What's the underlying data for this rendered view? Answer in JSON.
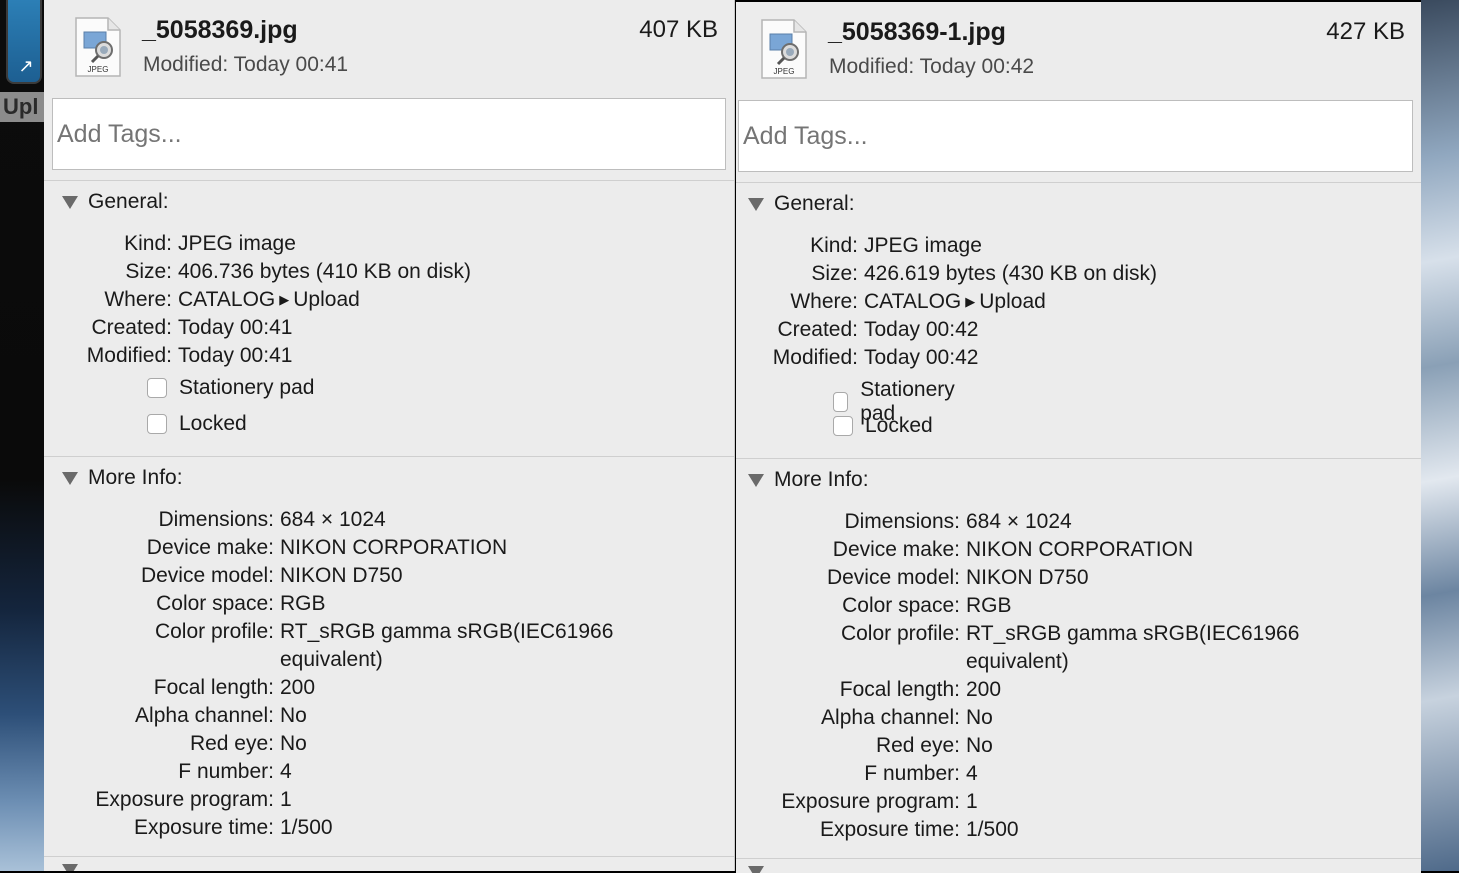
{
  "desktop": {
    "dock_label": "Upl"
  },
  "panels": [
    {
      "file_name": "_5058369.jpg",
      "file_size": "407 KB",
      "modified_line": "Modified: Today 00:41",
      "icon_badge": "JPEG",
      "tags_placeholder": "Add Tags...",
      "general": {
        "title": "General:",
        "kind_label": "Kind:",
        "kind": "JPEG image",
        "size_label": "Size:",
        "size": "406.736 bytes (410 KB on disk)",
        "where_label": "Where:",
        "where_path": [
          "CATALOG",
          "Upload"
        ],
        "created_label": "Created:",
        "created": "Today 00:41",
        "modified_label": "Modified:",
        "modified": "Today 00:41",
        "stationery_label": "Stationery pad",
        "locked_label": "Locked"
      },
      "more_info": {
        "title": "More Info:",
        "dimensions_label": "Dimensions:",
        "dimensions": "684 × 1024",
        "device_make_label": "Device make:",
        "device_make": "NIKON CORPORATION",
        "device_model_label": "Device model:",
        "device_model": "NIKON D750",
        "color_space_label": "Color space:",
        "color_space": "RGB",
        "color_profile_label": "Color profile:",
        "color_profile_1": "RT_sRGB gamma sRGB(IEC61966",
        "color_profile_2": "equivalent)",
        "focal_length_label": "Focal length:",
        "focal_length": "200",
        "alpha_channel_label": "Alpha channel:",
        "alpha_channel": "No",
        "red_eye_label": "Red eye:",
        "red_eye": "No",
        "f_number_label": "F number:",
        "f_number": "4",
        "exposure_program_label": "Exposure program:",
        "exposure_program": "1",
        "exposure_time_label": "Exposure time:",
        "exposure_time": "1/500"
      }
    },
    {
      "file_name": "_5058369-1.jpg",
      "file_size": "427 KB",
      "modified_line": "Modified: Today 00:42",
      "icon_badge": "JPEG",
      "tags_placeholder": "Add Tags...",
      "general": {
        "title": "General:",
        "kind_label": "Kind:",
        "kind": "JPEG image",
        "size_label": "Size:",
        "size": "426.619 bytes (430 KB on disk)",
        "where_label": "Where:",
        "where_path": [
          "CATALOG",
          "Upload"
        ],
        "created_label": "Created:",
        "created": "Today 00:42",
        "modified_label": "Modified:",
        "modified": "Today 00:42",
        "stationery_label": "Stationery pad",
        "locked_label": "Locked"
      },
      "more_info": {
        "title": "More Info:",
        "dimensions_label": "Dimensions:",
        "dimensions": "684 × 1024",
        "device_make_label": "Device make:",
        "device_make": "NIKON CORPORATION",
        "device_model_label": "Device model:",
        "device_model": "NIKON D750",
        "color_space_label": "Color space:",
        "color_space": "RGB",
        "color_profile_label": "Color profile:",
        "color_profile_1": "RT_sRGB gamma sRGB(IEC61966",
        "color_profile_2": "equivalent)",
        "focal_length_label": "Focal length:",
        "focal_length": "200",
        "alpha_channel_label": "Alpha channel:",
        "alpha_channel": "No",
        "red_eye_label": "Red eye:",
        "red_eye": "No",
        "f_number_label": "F number:",
        "f_number": "4",
        "exposure_program_label": "Exposure program:",
        "exposure_program": "1",
        "exposure_time_label": "Exposure time:",
        "exposure_time": "1/500"
      }
    }
  ]
}
